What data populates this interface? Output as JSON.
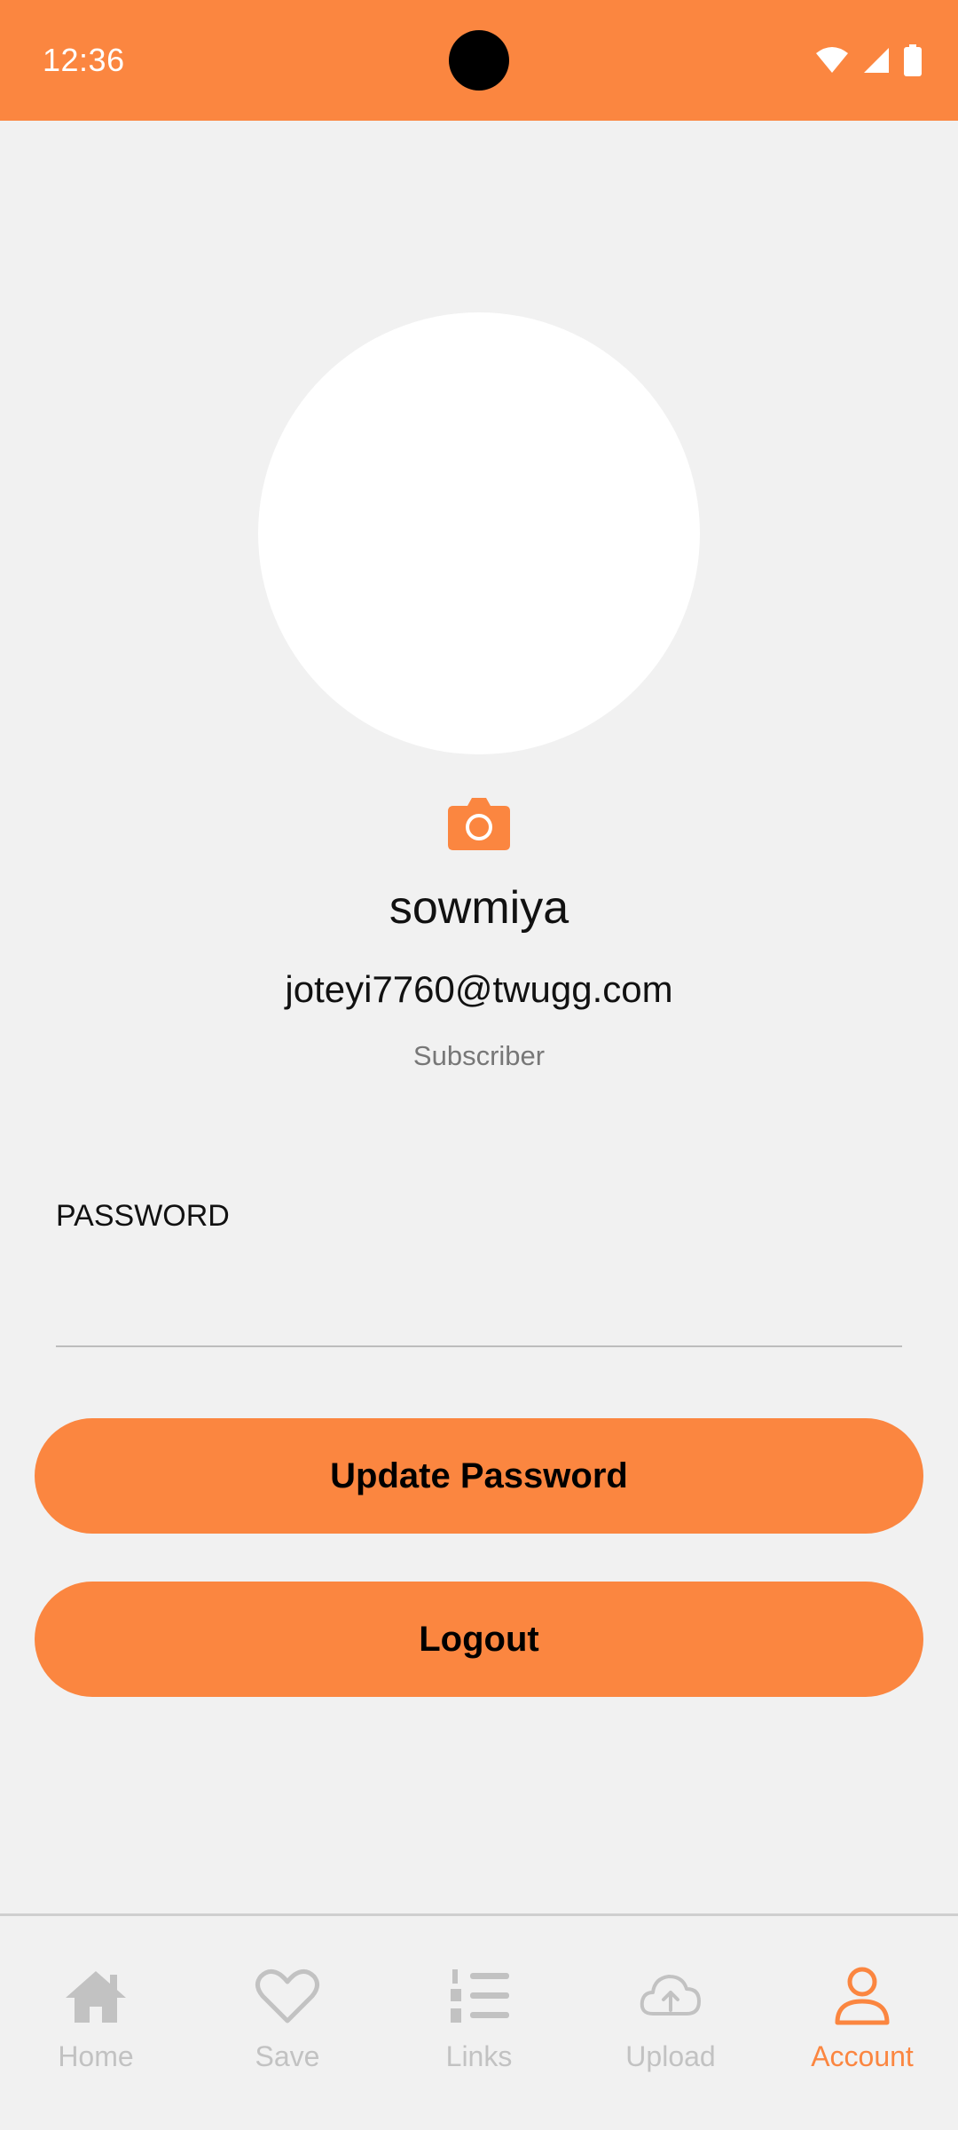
{
  "status_bar": {
    "time": "12:36",
    "icons": [
      "wifi-icon",
      "signal-icon",
      "battery-icon"
    ]
  },
  "profile": {
    "name": "sowmiya",
    "email": "joteyi7760@twugg.com",
    "role": "Subscriber",
    "camera_icon": "camera-icon"
  },
  "password_field": {
    "label": "PASSWORD",
    "value": ""
  },
  "buttons": {
    "update_password": "Update Password",
    "logout": "Logout"
  },
  "bottom_nav": {
    "items": [
      {
        "label": "Home",
        "icon": "home-icon",
        "active": false
      },
      {
        "label": "Save",
        "icon": "heart-icon",
        "active": false
      },
      {
        "label": "Links",
        "icon": "list-icon",
        "active": false
      },
      {
        "label": "Upload",
        "icon": "cloud-upload-icon",
        "active": false
      },
      {
        "label": "Account",
        "icon": "user-icon",
        "active": true
      }
    ]
  },
  "colors": {
    "accent": "#fb8640",
    "background": "#f1f1f1",
    "inactive": "#c2c2c2"
  }
}
